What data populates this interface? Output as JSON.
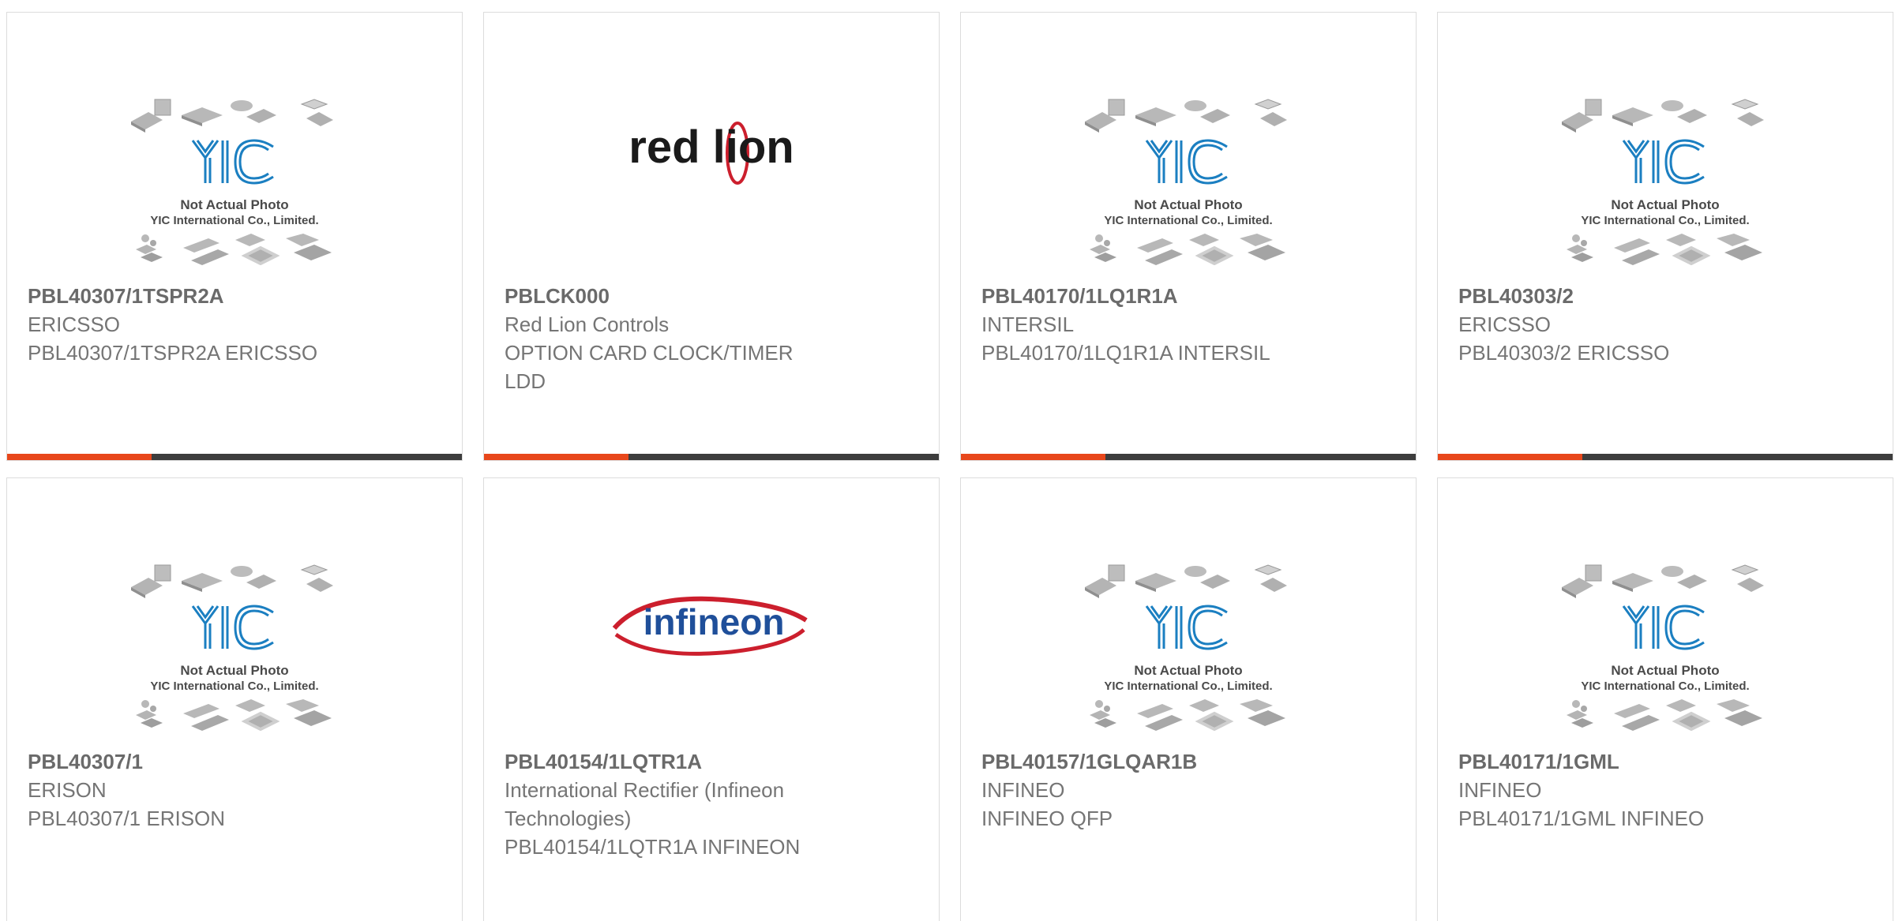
{
  "colors": {
    "accent": "#e8471b",
    "bar_dark": "#3d3d3d",
    "text": "#757575",
    "yic_blue": "#1b7fc1",
    "redlion_red": "#cc1f2d",
    "infineon_blue": "#1f4f9a"
  },
  "placeholder": {
    "line1": "Not Actual Photo",
    "line2": "YIC International Co., Limited."
  },
  "logos": {
    "redlion": "red lion",
    "infineon": "infineon"
  },
  "products": [
    {
      "part": "PBL40307/1TSPR2A",
      "maker": "ERICSSO",
      "desc": "PBL40307/1TSPR2A ERICSSO",
      "image": "yic-placeholder"
    },
    {
      "part": "PBLCK000",
      "maker": "Red Lion Controls",
      "desc": "OPTION CARD CLOCK/TIMER LDD",
      "image": "redlion-logo"
    },
    {
      "part": "PBL40170/1LQ1R1A",
      "maker": "INTERSIL",
      "desc": "PBL40170/1LQ1R1A INTERSIL",
      "image": "yic-placeholder"
    },
    {
      "part": "PBL40303/2",
      "maker": "ERICSSO",
      "desc": "PBL40303/2 ERICSSO",
      "image": "yic-placeholder"
    },
    {
      "part": "PBL40307/1",
      "maker": "ERISON",
      "desc": "PBL40307/1 ERISON",
      "image": "yic-placeholder"
    },
    {
      "part": "PBL40154/1LQTR1A",
      "maker": "International Rectifier (Infineon Technologies)",
      "desc": "PBL40154/1LQTR1A INFINEON",
      "image": "infineon-logo"
    },
    {
      "part": "PBL40157/1GLQAR1B",
      "maker": "INFINEO",
      "desc": "INFINEO QFP",
      "image": "yic-placeholder"
    },
    {
      "part": "PBL40171/1GML",
      "maker": "INFINEO",
      "desc": "PBL40171/1GML INFINEO",
      "image": "yic-placeholder"
    }
  ]
}
